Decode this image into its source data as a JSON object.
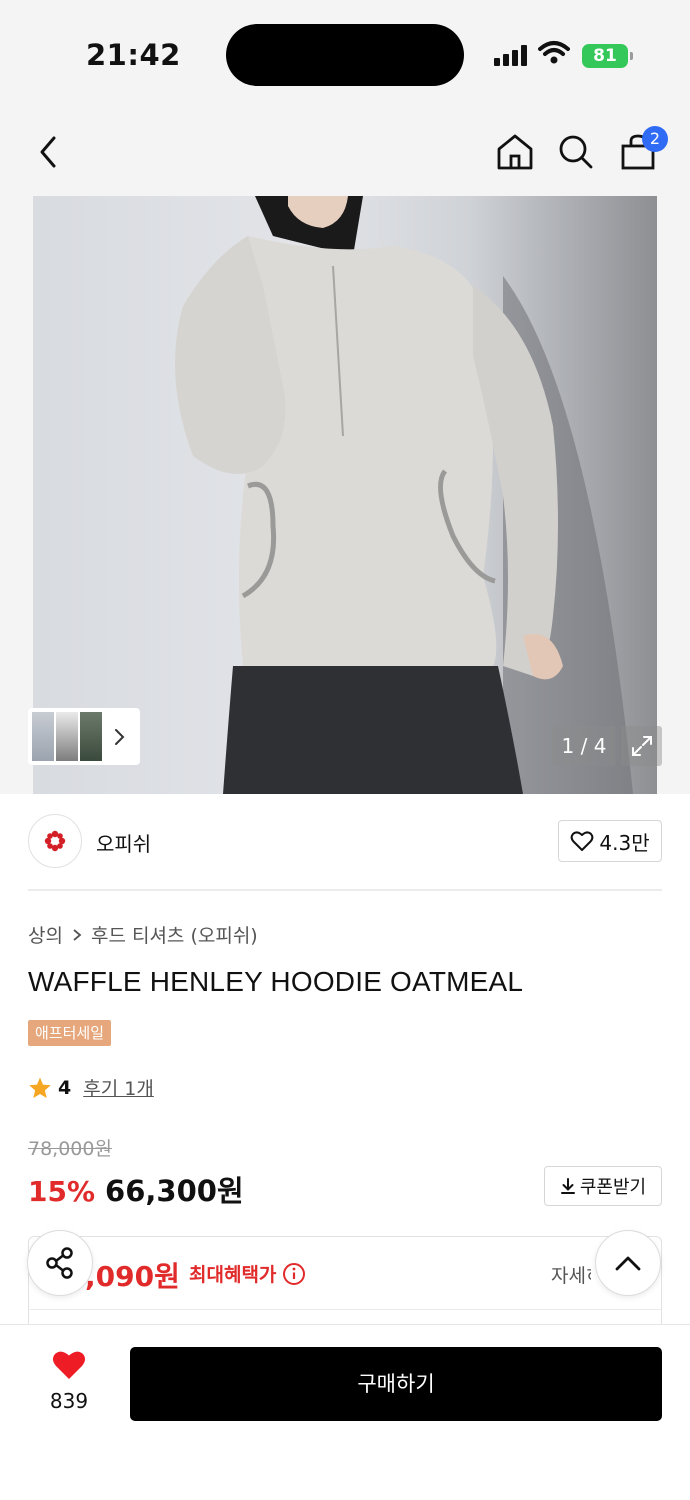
{
  "status_bar": {
    "time": "21:42",
    "battery": "81"
  },
  "nav": {
    "cart_count": "2"
  },
  "gallery": {
    "pager": "1 / 4"
  },
  "brand": {
    "name": "오피쉬",
    "likes": "4.3만"
  },
  "breadcrumb": {
    "category": "상의",
    "subcategory": "후드 티셔츠 (오피쉬)"
  },
  "product": {
    "title": "WAFFLE HENLEY HOODIE OATMEAL",
    "badge": "애프터세일",
    "rating": "4",
    "reviews": "후기 1개",
    "original_price": "78,000원",
    "discount": "15%",
    "price": "66,300원",
    "coupon_label": "쿠폰받기"
  },
  "benefit": {
    "price": ",090원",
    "label": "최대혜택가",
    "detail": "자세히"
  },
  "bottom": {
    "wish_count": "839",
    "buy_label": "구매하기"
  },
  "colors": {
    "accent_red": "#e12b2b",
    "badge_orange": "#e5a77b",
    "cart_badge_blue": "#2f6bf5"
  }
}
